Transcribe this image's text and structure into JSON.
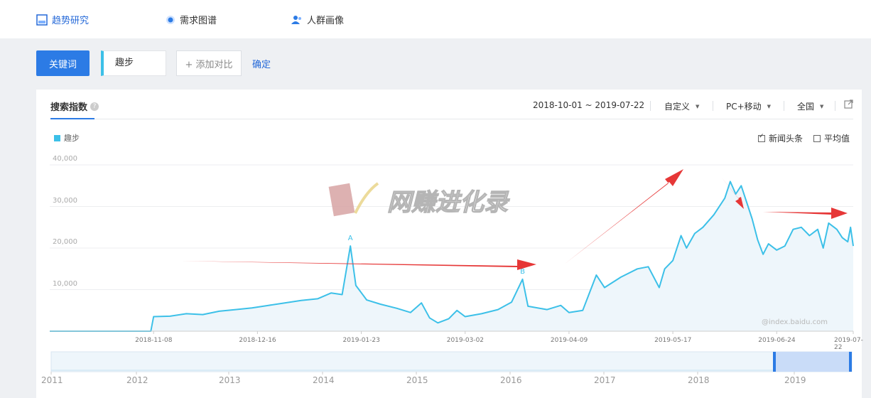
{
  "topnav": {
    "items": [
      {
        "label": "趋势研究",
        "icon": "trend-chart-icon"
      },
      {
        "label": "需求图谱",
        "icon": "demand-graph-icon"
      },
      {
        "label": "人群画像",
        "icon": "user-profile-icon"
      }
    ]
  },
  "query": {
    "keyword_button": "关键词",
    "keyword_value": "趣步",
    "add_compare": "+ 添加对比",
    "confirm": "确定"
  },
  "panel": {
    "title": "搜索指数",
    "help_icon": "question-icon",
    "date_range": "2018-10-01 ~ 2019-07-22",
    "range_mode": "自定义",
    "device": "PC+移动",
    "region": "全国",
    "export_icon": "external-link-icon",
    "legend_label": "趣步",
    "news_checkbox": "新闻头条",
    "news_checked": true,
    "avg_checkbox": "平均值",
    "avg_checked": false,
    "watermark": "@index.baidu.com",
    "overlay_text": "网赚进化录"
  },
  "chart_data": {
    "type": "line",
    "x_ticks": [
      "2018-11-08",
      "2018-12-16",
      "2019-01-23",
      "2019-03-02",
      "2019-04-09",
      "2019-05-17",
      "2019-06-24",
      "2019-07-22"
    ],
    "y_ticks": [
      "10,000",
      "20,000",
      "30,000",
      "40,000"
    ],
    "ylim": [
      0,
      40000
    ],
    "series_color": "#3cc0e8",
    "annotations": [
      {
        "label": "A",
        "date": "2019-01-19",
        "value": 20500
      },
      {
        "label": "B",
        "date": "2019-03-23",
        "value": 12500
      }
    ],
    "series": [
      {
        "name": "趣步",
        "points": [
          [
            "2018-10-01",
            0
          ],
          [
            "2018-11-07",
            0
          ],
          [
            "2018-11-08",
            3500
          ],
          [
            "2018-11-14",
            3600
          ],
          [
            "2018-11-20",
            4200
          ],
          [
            "2018-11-26",
            4000
          ],
          [
            "2018-12-02",
            4800
          ],
          [
            "2018-12-08",
            5200
          ],
          [
            "2018-12-14",
            5600
          ],
          [
            "2018-12-20",
            6200
          ],
          [
            "2018-12-26",
            6800
          ],
          [
            "2019-01-01",
            7400
          ],
          [
            "2019-01-07",
            7800
          ],
          [
            "2019-01-12",
            9200
          ],
          [
            "2019-01-16",
            8800
          ],
          [
            "2019-01-19",
            20500
          ],
          [
            "2019-01-21",
            11000
          ],
          [
            "2019-01-25",
            7500
          ],
          [
            "2019-01-30",
            6500
          ],
          [
            "2019-02-05",
            5500
          ],
          [
            "2019-02-10",
            4500
          ],
          [
            "2019-02-14",
            6800
          ],
          [
            "2019-02-17",
            3200
          ],
          [
            "2019-02-20",
            2000
          ],
          [
            "2019-02-24",
            3000
          ],
          [
            "2019-02-27",
            5000
          ],
          [
            "2019-03-02",
            3500
          ],
          [
            "2019-03-08",
            4200
          ],
          [
            "2019-03-14",
            5200
          ],
          [
            "2019-03-19",
            7000
          ],
          [
            "2019-03-23",
            12500
          ],
          [
            "2019-03-25",
            6000
          ],
          [
            "2019-04-01",
            5200
          ],
          [
            "2019-04-06",
            6200
          ],
          [
            "2019-04-09",
            4500
          ],
          [
            "2019-04-14",
            5000
          ],
          [
            "2019-04-19",
            13500
          ],
          [
            "2019-04-22",
            10500
          ],
          [
            "2019-04-28",
            13000
          ],
          [
            "2019-05-04",
            15000
          ],
          [
            "2019-05-08",
            15500
          ],
          [
            "2019-05-12",
            10500
          ],
          [
            "2019-05-14",
            15000
          ],
          [
            "2019-05-17",
            17000
          ],
          [
            "2019-05-20",
            23000
          ],
          [
            "2019-05-22",
            20000
          ],
          [
            "2019-05-25",
            23500
          ],
          [
            "2019-05-28",
            25000
          ],
          [
            "2019-06-01",
            28000
          ],
          [
            "2019-06-05",
            32000
          ],
          [
            "2019-06-07",
            36000
          ],
          [
            "2019-06-09",
            33000
          ],
          [
            "2019-06-11",
            35000
          ],
          [
            "2019-06-13",
            31000
          ],
          [
            "2019-06-15",
            27000
          ],
          [
            "2019-06-17",
            22000
          ],
          [
            "2019-06-19",
            18500
          ],
          [
            "2019-06-21",
            21000
          ],
          [
            "2019-06-24",
            19500
          ],
          [
            "2019-06-27",
            20500
          ],
          [
            "2019-06-30",
            24500
          ],
          [
            "2019-07-03",
            25000
          ],
          [
            "2019-07-06",
            23000
          ],
          [
            "2019-07-09",
            24500
          ],
          [
            "2019-07-11",
            20000
          ],
          [
            "2019-07-13",
            26000
          ],
          [
            "2019-07-16",
            24500
          ],
          [
            "2019-07-18",
            22500
          ],
          [
            "2019-07-20",
            21500
          ],
          [
            "2019-07-21",
            25000
          ],
          [
            "2019-07-22",
            20500
          ]
        ]
      }
    ],
    "overview": {
      "year_ticks": [
        "2011",
        "2012",
        "2013",
        "2014",
        "2015",
        "2016",
        "2017",
        "2018",
        "2019"
      ],
      "selected_range": [
        "2018-10-01",
        "2019-07-22"
      ]
    }
  }
}
